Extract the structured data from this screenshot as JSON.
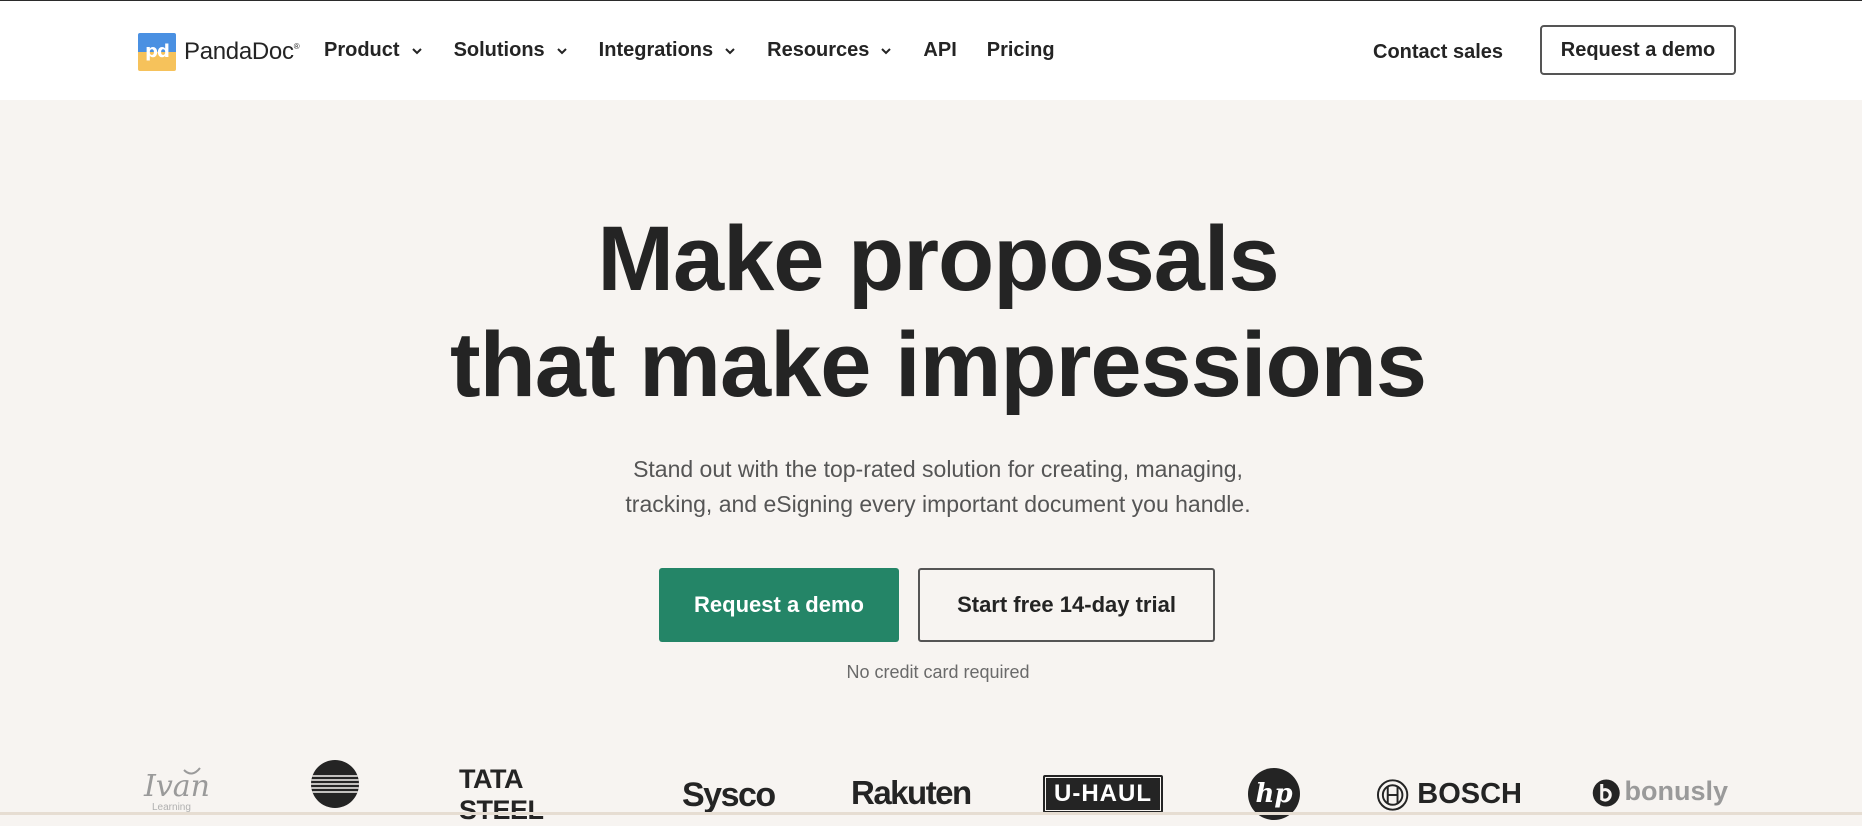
{
  "brand": {
    "name": "PandaDoc",
    "mark_text": "pd",
    "registered": "®",
    "colors": {
      "blue": "#4a90e2",
      "yellow": "#f6c25b",
      "primary_green": "#248567"
    }
  },
  "nav": {
    "items": [
      {
        "label": "Product",
        "dropdown": true
      },
      {
        "label": "Solutions",
        "dropdown": true
      },
      {
        "label": "Integrations",
        "dropdown": true
      },
      {
        "label": "Resources",
        "dropdown": true
      },
      {
        "label": "API",
        "dropdown": false
      },
      {
        "label": "Pricing",
        "dropdown": false
      }
    ],
    "contact_sales": "Contact sales",
    "request_demo": "Request a demo"
  },
  "hero": {
    "headline_line1": "Make proposals",
    "headline_line2": "that make impressions",
    "subtext_line1": "Stand out with the top-rated solution for creating, managing,",
    "subtext_line2": "tracking, and eSigning every important document you handle.",
    "primary_cta": "Request a demo",
    "secondary_cta": "Start free 14-day trial",
    "note": "No credit card required"
  },
  "client_logos": [
    {
      "name": "Ivan Learning",
      "text": "Ivan",
      "subtext": "Learning"
    },
    {
      "name": "Toshiba-style globe",
      "text": ""
    },
    {
      "name": "Tata Steel",
      "text": "TATA STEEL"
    },
    {
      "name": "Sysco",
      "text": "Sysco"
    },
    {
      "name": "Rakuten",
      "text": "Rakuten"
    },
    {
      "name": "U-Haul",
      "text": "U-HAUL"
    },
    {
      "name": "HP",
      "text": "hp"
    },
    {
      "name": "Bosch",
      "text": "BOSCH"
    },
    {
      "name": "Bonusly",
      "text": "bonusly"
    }
  ]
}
